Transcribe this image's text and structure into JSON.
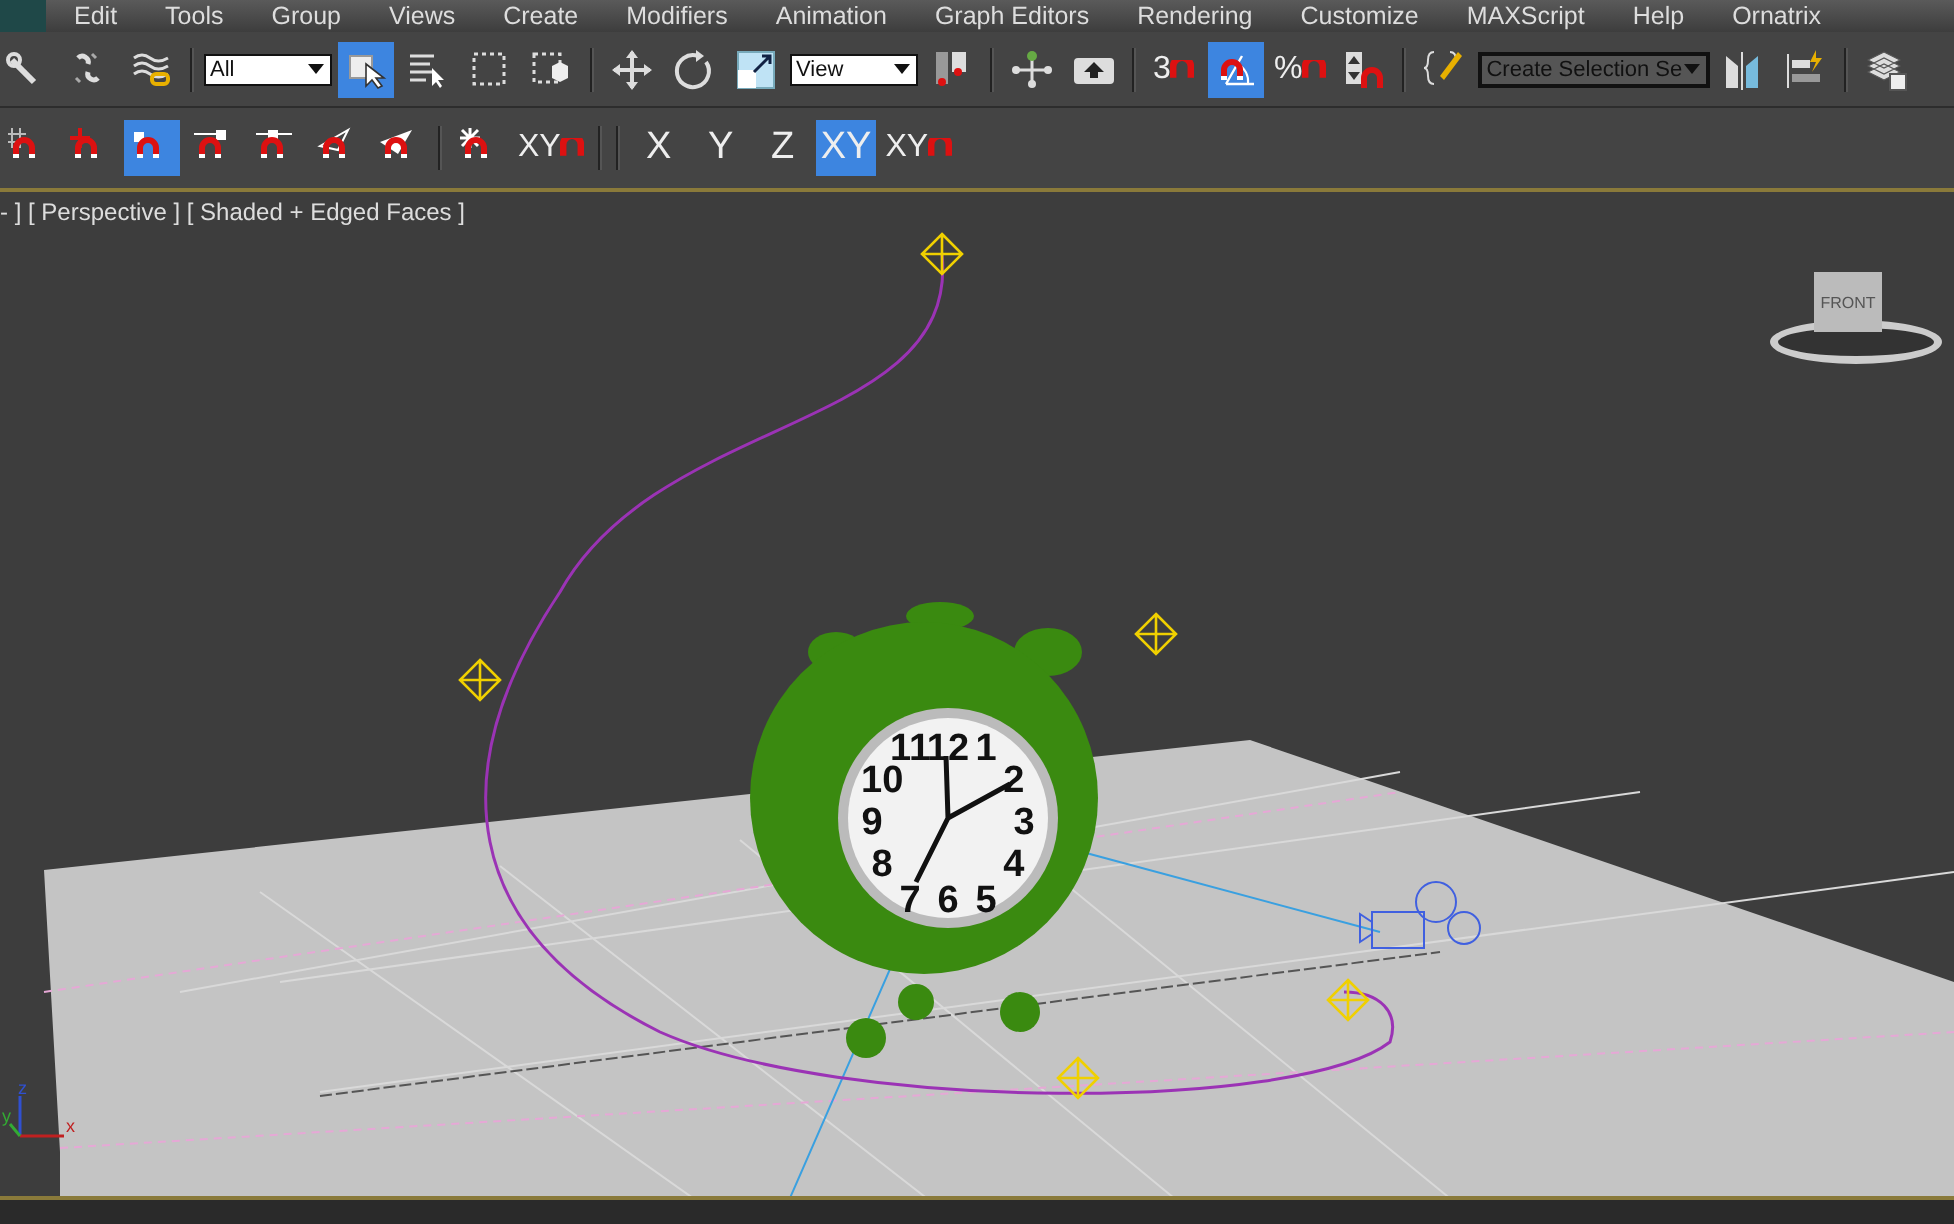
{
  "menu_bar": {
    "items": [
      "Edit",
      "Tools",
      "Group",
      "Views",
      "Create",
      "Modifiers",
      "Animation",
      "Graph Editors",
      "Rendering",
      "Customize",
      "MAXScript",
      "Help",
      "Ornatrix"
    ]
  },
  "main_toolbar": [
    {
      "kind": "icon",
      "selected": false
    },
    {
      "kind": "icon",
      "selected": false
    },
    {
      "kind": "icon",
      "selected": false
    },
    {
      "kind": "sep"
    },
    {
      "kind": "dropdown",
      "value": "All"
    },
    {
      "kind": "icon",
      "selected": true
    },
    {
      "kind": "icon",
      "selected": false
    },
    {
      "kind": "icon",
      "selected": false
    },
    {
      "kind": "icon",
      "selected": false
    },
    {
      "kind": "sep"
    },
    {
      "kind": "icon",
      "selected": false
    },
    {
      "kind": "icon",
      "selected": false
    },
    {
      "kind": "icon",
      "selected": false
    },
    {
      "kind": "dropdown",
      "value": "View"
    },
    {
      "kind": "icon",
      "selected": false
    },
    {
      "kind": "sep"
    },
    {
      "kind": "icon",
      "selected": false
    },
    {
      "kind": "icon",
      "selected": false
    },
    {
      "kind": "sep"
    },
    {
      "kind": "snap",
      "label": "3",
      "selected": false
    },
    {
      "kind": "icon",
      "selected": true
    },
    {
      "kind": "snap",
      "label": "%",
      "selected": false
    },
    {
      "kind": "icon",
      "selected": false
    },
    {
      "kind": "sep"
    },
    {
      "kind": "icon",
      "selected": false
    },
    {
      "kind": "wide-dropdown",
      "value": "Create Selection Se"
    },
    {
      "kind": "icon",
      "selected": false
    },
    {
      "kind": "icon",
      "selected": false
    },
    {
      "kind": "sep"
    },
    {
      "kind": "icon",
      "selected": false
    }
  ],
  "snap_toolbar": [
    {
      "kind": "icon",
      "selected": false
    },
    {
      "kind": "icon",
      "selected": false
    },
    {
      "kind": "icon",
      "selected": true
    },
    {
      "kind": "icon",
      "selected": false
    },
    {
      "kind": "icon",
      "selected": false
    },
    {
      "kind": "icon",
      "selected": false
    },
    {
      "kind": "icon",
      "selected": false
    },
    {
      "kind": "sep"
    },
    {
      "kind": "icon",
      "selected": false
    },
    {
      "kind": "snap",
      "label": "XY",
      "selected": false
    }
  ],
  "axis_toolbar": [
    {
      "kind": "axis",
      "label": "X",
      "selected": false
    },
    {
      "kind": "axis",
      "label": "Y",
      "selected": false
    },
    {
      "kind": "axis",
      "label": "Z",
      "selected": false
    },
    {
      "kind": "axis",
      "label": "XY",
      "selected": true
    },
    {
      "kind": "snap",
      "label": "XY",
      "selected": false
    }
  ],
  "viewport": {
    "label": "- ] [ Perspective ] [ Shaded + Edged Faces ]",
    "view_cube_label": "FRONT",
    "clock_numerals": [
      "11",
      "12",
      "1",
      "10",
      "2",
      "9",
      "3",
      "8",
      "4",
      "7",
      "6",
      "5"
    ],
    "axis_labels": {
      "z": "z",
      "y": "y",
      "x": "x"
    }
  }
}
